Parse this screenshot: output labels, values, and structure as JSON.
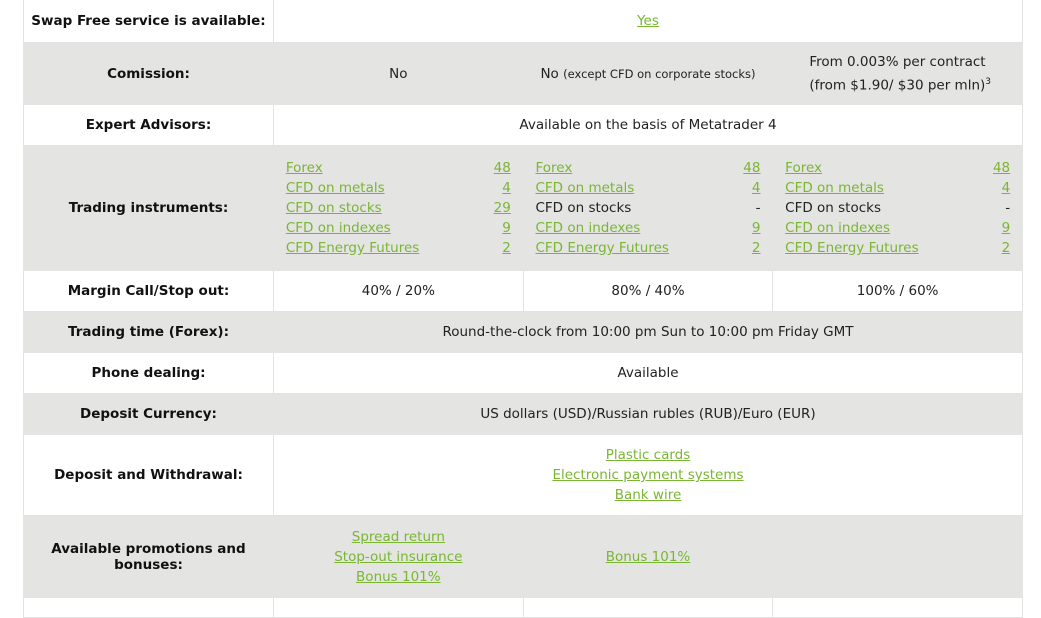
{
  "colors": {
    "link": "#7ab534",
    "row_alt": "#e4e4e3",
    "border": "#e2e2e2"
  },
  "rows": {
    "swap_free": {
      "label": "Swap Free service is available:",
      "value": "Yes"
    },
    "commission": {
      "label": "Comission:",
      "col1": "No",
      "col2_main": "No",
      "col2_note": "(except CFD on corporate stocks)",
      "col3_line1": "From 0.003% per contract",
      "col3_line2": "(from $1.90/ $30 per mln)",
      "col3_sup": "3"
    },
    "expert_advisors": {
      "label": "Expert Advisors:",
      "value": "Available on the basis of Metatrader 4"
    },
    "trading_instruments": {
      "label": "Trading instruments:",
      "columns": [
        {
          "items": [
            {
              "name": "Forex",
              "count": "48",
              "link": true
            },
            {
              "name": "CFD on metals",
              "count": "4",
              "link": true
            },
            {
              "name": "CFD on stocks",
              "count": "29",
              "link": true
            },
            {
              "name": "CFD on indexes",
              "count": "9",
              "link": true
            },
            {
              "name": "CFD Energy Futures",
              "count": "2",
              "link": true
            }
          ]
        },
        {
          "items": [
            {
              "name": "Forex",
              "count": "48",
              "link": true
            },
            {
              "name": "CFD on metals",
              "count": "4",
              "link": true
            },
            {
              "name": "CFD on stocks",
              "count": "-",
              "link": false
            },
            {
              "name": "CFD on indexes",
              "count": "9",
              "link": true
            },
            {
              "name": "CFD Energy Futures",
              "count": "2",
              "link": true
            }
          ]
        },
        {
          "items": [
            {
              "name": "Forex",
              "count": "48",
              "link": true
            },
            {
              "name": "CFD on metals",
              "count": "4",
              "link": true
            },
            {
              "name": "CFD on stocks",
              "count": "-",
              "link": false
            },
            {
              "name": "CFD on indexes",
              "count": "9",
              "link": true
            },
            {
              "name": "CFD Energy Futures",
              "count": "2",
              "link": true
            }
          ]
        }
      ]
    },
    "margin_call": {
      "label": "Margin Call/Stop out:",
      "col1": "40% / 20%",
      "col2": "80% / 40%",
      "col3": "100% / 60%"
    },
    "trading_time": {
      "label": "Trading time (Forex):",
      "value": "Round-the-clock from 10:00 pm Sun to 10:00 pm Friday GMT"
    },
    "phone_dealing": {
      "label": "Phone dealing:",
      "value": "Available"
    },
    "deposit_currency": {
      "label": "Deposit Currency:",
      "value": "US dollars (USD)/Russian rubles (RUB)/Euro (EUR)"
    },
    "deposit_withdrawal": {
      "label": "Deposit and Withdrawal:",
      "links": [
        "Plastic cards",
        "Electronic payment systems",
        "Bank wire"
      ]
    },
    "promotions": {
      "label": "Available promotions and bonuses:",
      "col1": [
        "Spread return",
        "Stop-out insurance",
        "Bonus 101%"
      ],
      "col2": [
        "Bonus 101%"
      ],
      "col3": []
    }
  }
}
